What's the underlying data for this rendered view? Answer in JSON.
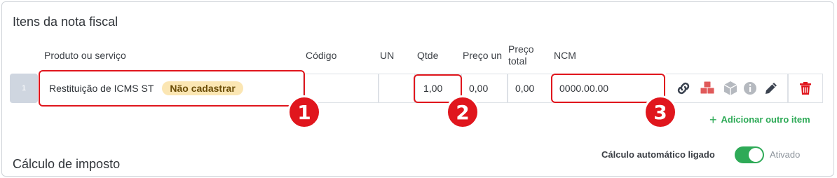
{
  "items_section": {
    "title": "Itens da nota fiscal",
    "headers": {
      "produto": "Produto ou serviço",
      "codigo": "Código",
      "un": "UN",
      "qtde": "Qtde",
      "preco_un": "Preço un",
      "preco_total_line1": "Preço",
      "preco_total_line2": "total",
      "ncm": "NCM"
    },
    "row": {
      "number": "1",
      "product": "Restituição de ICMS ST",
      "badge": "Não cadastrar",
      "code": "",
      "un": "",
      "qtde": "1,00",
      "preco_un": "0,00",
      "preco_total": "0,00",
      "ncm": "0000.00.00"
    },
    "row_icons": [
      "link-icon",
      "boxes-icon",
      "box-icon",
      "info-icon",
      "pencil-icon",
      "trash-icon"
    ],
    "add_item_label": "Adicionar outro item"
  },
  "callouts": [
    "1",
    "2",
    "3"
  ],
  "tax_section": {
    "title": "Cálculo de imposto",
    "auto_calc_label": "Cálculo automático ligado",
    "auto_calc_state": "Ativado",
    "auto_calc_on": true
  },
  "colors": {
    "accent_green": "#2eaa57",
    "callout_red": "#e0161d",
    "badge_bg": "#fbe6b3",
    "icon_red": "#e05a5a"
  }
}
